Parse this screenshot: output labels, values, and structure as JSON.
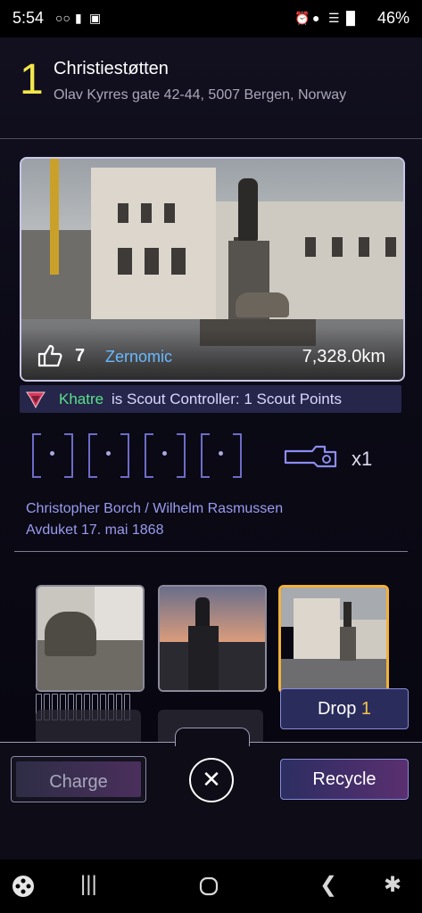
{
  "status_bar": {
    "time": "5:54",
    "battery": "46%"
  },
  "portal": {
    "level": "1",
    "name": "Christiestøtten",
    "address": "Olav Kyrres gate 42-44, 5007 Bergen, Norway"
  },
  "photo": {
    "likes": "7",
    "uploader": "Zernomic",
    "distance": "7,328.0km"
  },
  "scout": {
    "name": "Khatre",
    "text": "is Scout Controller: 1 Scout Points"
  },
  "mods": {
    "slots": 4,
    "key_count": "x1"
  },
  "description": {
    "line1": "Christopher Borch / Wilhelm Rasmussen",
    "line2": "Avduket 17. mai 1868"
  },
  "actions": {
    "drop_label": "Drop",
    "drop_count": "1",
    "charge_label": "Charge",
    "recycle_label": "Recycle"
  },
  "icons": [
    "photo-likes-icon",
    "scout-controller-icon",
    "mod-slot-icon",
    "key-icon",
    "close-icon",
    "game-icon",
    "recents-icon",
    "home-icon",
    "back-icon",
    "accessibility-icon"
  ],
  "colors": {
    "level": "#f3e74b",
    "owner": "#69b9ff",
    "scout_name": "#59e08a",
    "selected_thumb": "#f2b13a",
    "drop_count": "#f3c548"
  }
}
